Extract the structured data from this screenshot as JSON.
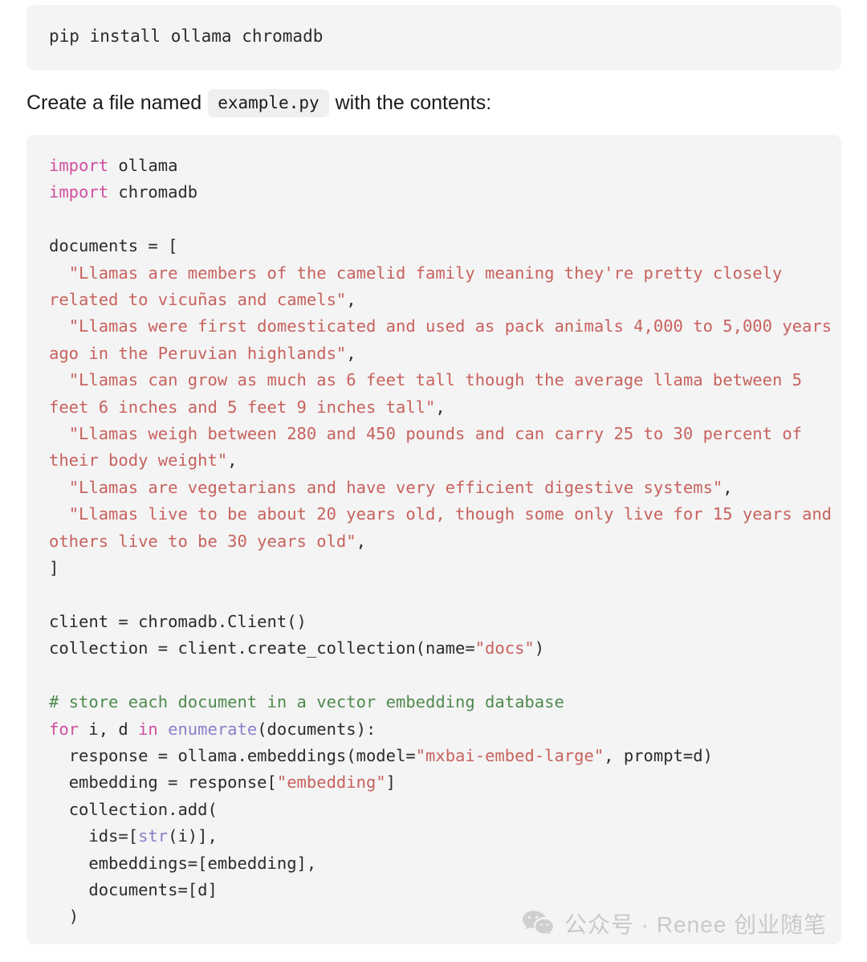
{
  "page": {
    "background": "#ffffff",
    "code_block_bg": "#f4f4f4",
    "inline_code_bg": "#efefef"
  },
  "install_block": {
    "language": "shell",
    "command": "pip install ollama chromadb"
  },
  "prose": {
    "before": "Create a file named",
    "file_name": "example.py",
    "after": "with the contents:"
  },
  "colors": {
    "keyword": "#cf4ea0",
    "string": "#c7625e",
    "comment": "#4f8a4f",
    "builtin": "#8b7ec8",
    "text": "#2b2b2b"
  },
  "code_block": {
    "language": "python",
    "documents": [
      "Llamas are members of the camelid family meaning they're pretty closely related to vicuñas and camels",
      "Llamas were first domesticated and used as pack animals 4,000 to 5,000 years ago in the Peruvian highlands",
      "Llamas can grow as much as 6 feet tall though the average llama between 5 feet 6 inches and 5 feet 9 inches tall",
      "Llamas weigh between 280 and 450 pounds and can carry 25 to 30 percent of their body weight",
      "Llamas are vegetarians and have very efficient digestive systems",
      "Llamas live to be about 20 years old, though some only live for 15 years and others live to be 30 years old"
    ],
    "comment": "# store each document in a vector embedding database",
    "collection_name": "docs",
    "model_name": "mxbai-embed-large",
    "embedding_key": "embedding",
    "lines": [
      "import ollama",
      "import chromadb",
      "",
      "documents = [",
      "  \"Llamas are members of the camelid family meaning they're pretty closely related to vicuñas and camels\",",
      "  \"Llamas were first domesticated and used as pack animals 4,000 to 5,000 years ago in the Peruvian highlands\",",
      "  \"Llamas can grow as much as 6 feet tall though the average llama between 5 feet 6 inches and 5 feet 9 inches tall\",",
      "  \"Llamas weigh between 280 and 450 pounds and can carry 25 to 30 percent of their body weight\",",
      "  \"Llamas are vegetarians and have very efficient digestive systems\",",
      "  \"Llamas live to be about 20 years old, though some only live for 15 years and others live to be 30 years old\",",
      "]",
      "",
      "client = chromadb.Client()",
      "collection = client.create_collection(name=\"docs\")",
      "",
      "# store each document in a vector embedding database",
      "for i, d in enumerate(documents):",
      "  response = ollama.embeddings(model=\"mxbai-embed-large\", prompt=d)",
      "  embedding = response[\"embedding\"]",
      "  collection.add(",
      "    ids=[str(i)],",
      "    embeddings=[embedding],",
      "    documents=[d]",
      "  )"
    ]
  },
  "watermark": {
    "icon": "wechat-icon",
    "text": "公众号 · Renee 创业随笔",
    "color": "#c9c9c9"
  }
}
